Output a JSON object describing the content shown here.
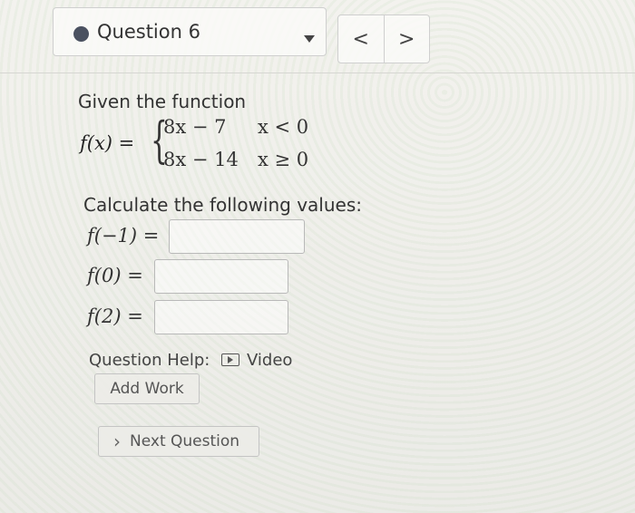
{
  "header": {
    "question_title": "Question 6",
    "prev_glyph": "<",
    "next_glyph": ">"
  },
  "problem": {
    "intro": "Given the function",
    "function_name": "f(x) =",
    "cases": [
      {
        "expr": "8x − 7",
        "condition": "x < 0"
      },
      {
        "expr": "8x − 14",
        "condition": "x ≥ 0"
      }
    ],
    "calc_prompt": "Calculate the following values:"
  },
  "answers": [
    {
      "label": "f(−1) =",
      "value": ""
    },
    {
      "label": "f(0) =",
      "value": ""
    },
    {
      "label": "f(2) =",
      "value": ""
    }
  ],
  "help": {
    "label": "Question Help:",
    "video_label": "Video",
    "add_work_label": "Add Work"
  },
  "footer": {
    "next_question_label": "Next Question",
    "next_question_glyph": "›"
  }
}
